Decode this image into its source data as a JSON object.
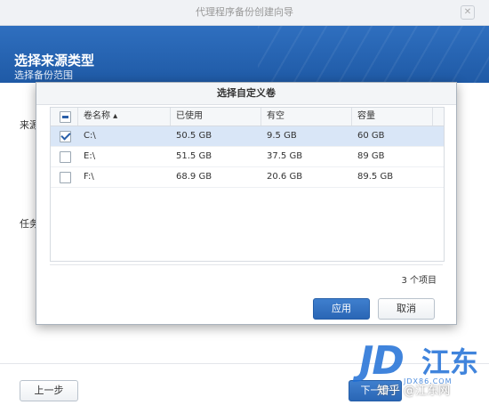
{
  "window": {
    "title": "代理程序备份创建向导",
    "close_glyph": "✕"
  },
  "banner": {
    "title": "选择来源类型",
    "subtitle": "选择备份范围"
  },
  "wizard": {
    "source_label_partial": "来源",
    "task_label_partial": "任务",
    "prev_button": "上一步",
    "next_button": "下一步"
  },
  "modal": {
    "title": "选择自定义卷",
    "columns": [
      "卷名称 ▴",
      "已使用",
      "有空",
      "容量"
    ],
    "rows": [
      {
        "name": "C:\\",
        "used": "50.5 GB",
        "free": "9.5 GB",
        "capacity": "60 GB",
        "checked": true
      },
      {
        "name": "E:\\",
        "used": "51.5 GB",
        "free": "37.5 GB",
        "capacity": "89 GB",
        "checked": false
      },
      {
        "name": "F:\\",
        "used": "68.9 GB",
        "free": "20.6 GB",
        "capacity": "89.5 GB",
        "checked": false
      }
    ],
    "item_count": "3 个项目",
    "apply_button": "应用",
    "cancel_button": "取消"
  },
  "watermark": {
    "brand": "JD",
    "brand_cn": "江东",
    "site": "JDX86.COM",
    "credit": "知乎 @江东网"
  },
  "colors": {
    "banner": "#1f5aa6",
    "selected_row": "#d9e6f7",
    "primary_button": "#2a66b5",
    "watermark": "#1f6fd6"
  }
}
